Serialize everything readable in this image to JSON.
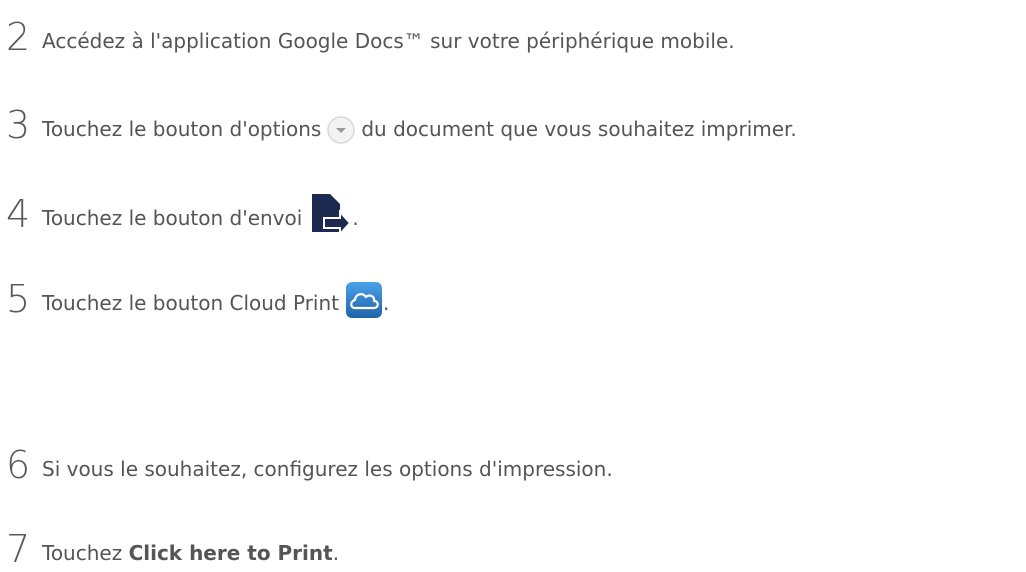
{
  "steps": [
    {
      "num": "2",
      "text": "Accédez à l'application Google Docs™ sur votre périphérique mobile."
    },
    {
      "num": "3",
      "before": "Touchez le bouton d'options",
      "after": "du document que vous souhaitez imprimer.",
      "icon": "options-chevron-icon"
    },
    {
      "num": "4",
      "before": "Touchez le bouton d'envoi",
      "after": ".",
      "icon": "send-icon"
    },
    {
      "num": "5",
      "before": "Touchez le bouton Cloud Print",
      "after": ".",
      "icon": "cloud-print-icon"
    },
    {
      "num": "6",
      "text": "Si vous le souhaitez, configurez les options d'impression."
    },
    {
      "num": "7",
      "before": "Touchez ",
      "strong": "Click here to Print",
      "after": "."
    }
  ],
  "colors": {
    "send_icon": "#1b2a4e",
    "cloud_icon_bg": "#2f80c8",
    "options_icon_circle": "#d9d9d9",
    "options_icon_chevron": "#9a9a9a"
  }
}
